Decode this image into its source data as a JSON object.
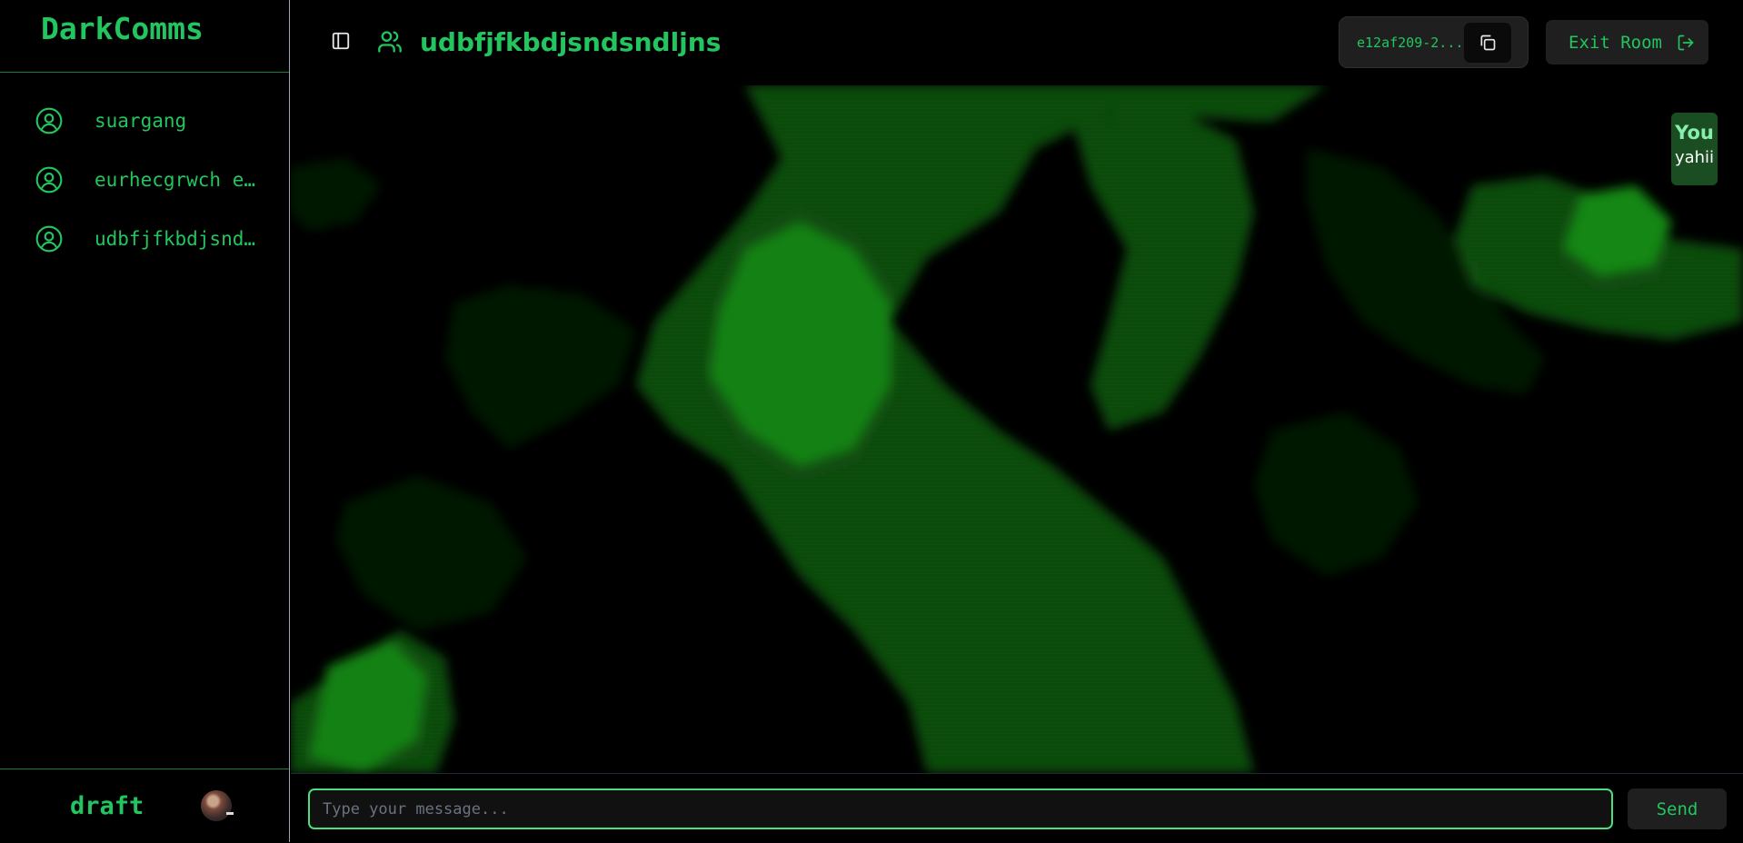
{
  "app": {
    "brand": "DarkComms"
  },
  "sidebar": {
    "users": [
      {
        "name": "suargang",
        "icon": "user-circle-icon"
      },
      {
        "name": "eurhecgrwch e…",
        "icon": "user-circle-icon"
      },
      {
        "name": "udbfjfkbdjsnd…",
        "icon": "user-circle-icon"
      }
    ],
    "footer": {
      "current_user": "draft",
      "avatar": "user-avatar"
    }
  },
  "header": {
    "room_title": "udbfjfkbdjsndsndljns",
    "room_id": "e12af209-2...",
    "exit_label": "Exit Room",
    "icons": {
      "toggle": "sidebar-toggle-icon",
      "room": "users-icon",
      "copy": "copy-icon",
      "exit": "log-out-icon"
    }
  },
  "messages": [
    {
      "sender": "You",
      "text": "yahii"
    }
  ],
  "composer": {
    "placeholder": "Type your message...",
    "value": "",
    "send_label": "Send"
  },
  "colors": {
    "accent": "#22c55e",
    "accent_light": "#4ade80",
    "background": "#000000",
    "panel": "#1f1f1f"
  }
}
